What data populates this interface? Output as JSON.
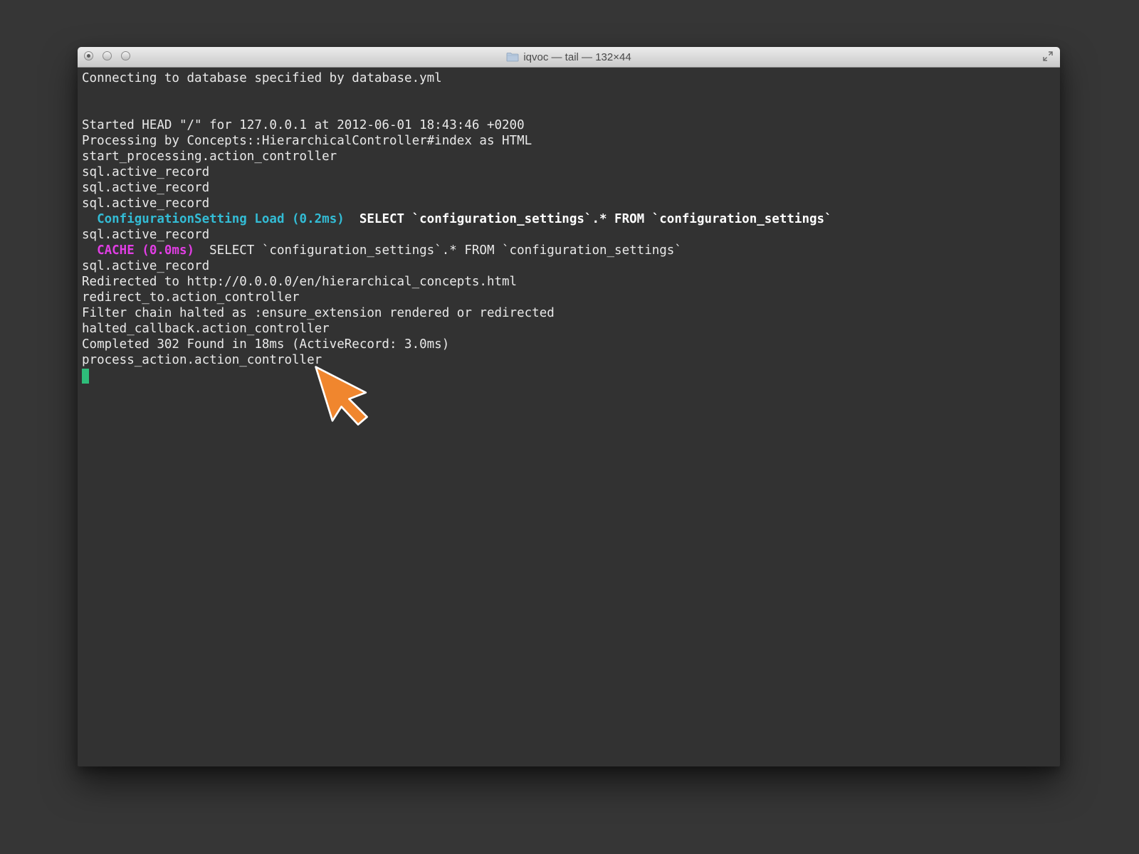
{
  "window": {
    "title": "iqvoc — tail — 132×44",
    "buttons": [
      "close",
      "minimize",
      "zoom"
    ]
  },
  "terminal": {
    "lines": [
      {
        "text": "Connecting to database specified by database.yml"
      },
      {
        "text": ""
      },
      {
        "text": ""
      },
      {
        "text": "Started HEAD \"/\" for 127.0.0.1 at 2012-06-01 18:43:46 +0200"
      },
      {
        "text": "Processing by Concepts::HierarchicalController#index as HTML"
      },
      {
        "text": "start_processing.action_controller"
      },
      {
        "text": "sql.active_record"
      },
      {
        "text": "sql.active_record"
      },
      {
        "text": "sql.active_record"
      },
      {
        "prefix": "  ",
        "label": "ConfigurationSetting Load (0.2ms)",
        "query": "  SELECT `configuration_settings`.* FROM `configuration_settings`"
      },
      {
        "text": "sql.active_record"
      },
      {
        "prefix": "  ",
        "label": "CACHE (0.0ms)",
        "query": "  SELECT `configuration_settings`.* FROM `configuration_settings`"
      },
      {
        "text": "sql.active_record"
      },
      {
        "text": "Redirected to http://0.0.0.0/en/hierarchical_concepts.html"
      },
      {
        "text": "redirect_to.action_controller"
      },
      {
        "text": "Filter chain halted as :ensure_extension rendered or redirected"
      },
      {
        "text": "halted_callback.action_controller"
      },
      {
        "text": "Completed 302 Found in 18ms (ActiveRecord: 3.0ms)"
      },
      {
        "text": "process_action.action_controller"
      }
    ]
  },
  "colors": {
    "background": "#363636",
    "terminal_bg": "#323232",
    "text": "#e9e9e9",
    "sql_label": "#33bcd5",
    "cache_label": "#e13ee4",
    "cursor": "#2ebd7a",
    "pointer": "#f0862e"
  },
  "icons": {
    "title": "folder-icon",
    "fullscreen": "fullscreen-icon",
    "pointer": "mouse-pointer-icon"
  }
}
